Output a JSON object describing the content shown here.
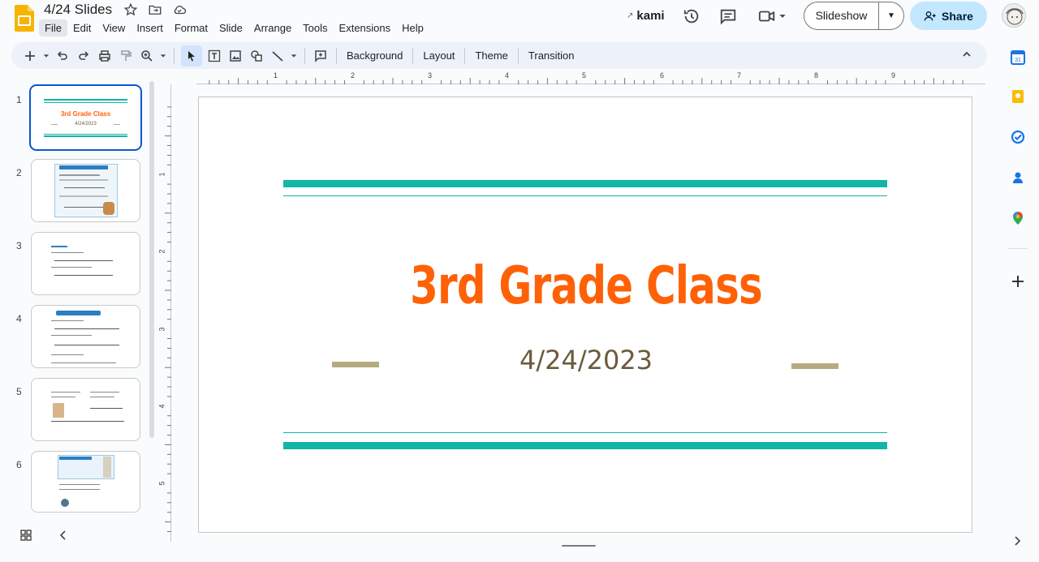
{
  "app": {
    "doc_title": "4/24 Slides",
    "menus": [
      "File",
      "Edit",
      "View",
      "Insert",
      "Format",
      "Slide",
      "Arrange",
      "Tools",
      "Extensions",
      "Help"
    ],
    "kami_label": "kami",
    "slideshow_label": "Slideshow",
    "share_label": "Share"
  },
  "toolbar": {
    "background_label": "Background",
    "layout_label": "Layout",
    "theme_label": "Theme",
    "transition_label": "Transition"
  },
  "filmstrip": {
    "numbers": [
      "1",
      "2",
      "3",
      "4",
      "5",
      "6"
    ],
    "slide1_title": "3rd Grade Class",
    "slide1_date": "4/24/2023"
  },
  "ruler": {
    "top_numbers": [
      "1",
      "2",
      "3",
      "4",
      "5",
      "6",
      "7",
      "8",
      "9"
    ],
    "left_numbers": [
      "1",
      "2",
      "3",
      "4",
      "5"
    ]
  },
  "slide": {
    "title": "3rd Grade Class",
    "subtitle": "4/24/2023",
    "colors": {
      "title": "#ff6107",
      "subtitle": "#6b5a3e",
      "teal_bars": "#12b5a6",
      "dashes": "#b5ab80"
    }
  },
  "side_panel": {
    "icons": [
      "calendar-icon",
      "keep-icon",
      "tasks-icon",
      "contacts-icon",
      "maps-icon",
      "add-icon"
    ]
  }
}
